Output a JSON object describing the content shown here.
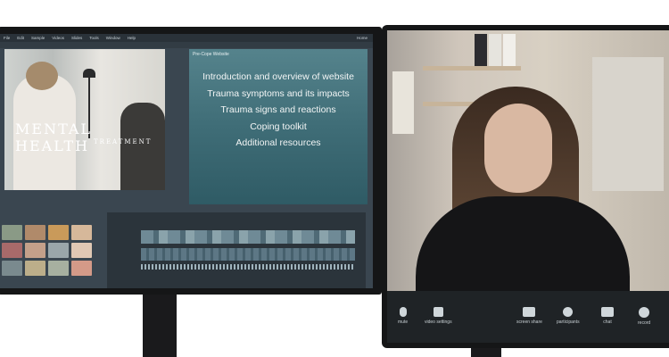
{
  "editor": {
    "menu": [
      "File",
      "Edit",
      "Sample",
      "Videos",
      "Slides",
      "Tools",
      "Window",
      "Help"
    ],
    "home_label": "Home",
    "scene_title": "MENTAL HEALTH",
    "scene_subtitle": "TREATMENT",
    "slide_header": "Pre-Cope Website",
    "slide_items": [
      "Introduction and overview of website",
      "Trauma symptoms and its impacts",
      "Trauma signs and reactions",
      "Coping toolkit",
      "Additional resources"
    ]
  },
  "call": {
    "controls": [
      {
        "label": "mute",
        "icon": "mic-icon"
      },
      {
        "label": "video settings",
        "icon": "video-icon"
      },
      {
        "label": "screen share",
        "icon": "screen-share-icon"
      },
      {
        "label": "participants",
        "icon": "participants-icon"
      },
      {
        "label": "chat",
        "icon": "chat-icon"
      },
      {
        "label": "record",
        "icon": "record-icon"
      }
    ]
  }
}
